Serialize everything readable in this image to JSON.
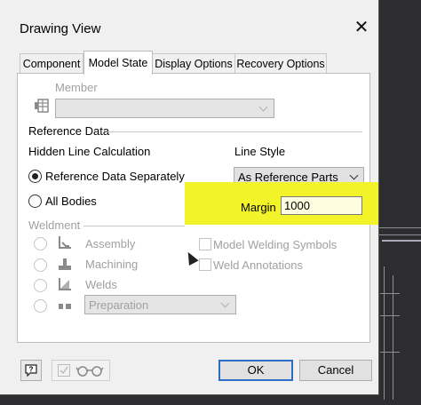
{
  "window": {
    "title": "Drawing View",
    "close_glyph": "✕"
  },
  "tabs": [
    {
      "label": "Component"
    },
    {
      "label": "Model State"
    },
    {
      "label": "Display Options"
    },
    {
      "label": "Recovery Options"
    }
  ],
  "member": {
    "label": "Member",
    "value": ""
  },
  "reference_data": {
    "section_label": "Reference Data",
    "hidden_line_label": "Hidden Line Calculation",
    "options": [
      {
        "label": "Reference Data Separately",
        "selected": true
      },
      {
        "label": "All Bodies",
        "selected": false
      }
    ],
    "line_style_label": "Line Style",
    "line_style_value": "As Reference Parts",
    "margin_label": "Margin",
    "margin_value": "1000"
  },
  "weldment": {
    "section_label": "Weldment",
    "options": [
      {
        "label": "Assembly",
        "icon": "assembly-icon"
      },
      {
        "label": "Machining",
        "icon": "machining-icon"
      },
      {
        "label": "Welds",
        "icon": "welds-icon"
      },
      {
        "label": "",
        "icon": "preparation-icon"
      }
    ],
    "preparation_value": "Preparation",
    "checkboxes": [
      {
        "label": "Model Welding Symbols",
        "checked": false
      },
      {
        "label": "Weld Annotations",
        "checked": false
      }
    ]
  },
  "footer": {
    "ok_label": "OK",
    "cancel_label": "Cancel"
  },
  "colors": {
    "highlight": "#f3f32a",
    "accent": "#2c6fc7"
  }
}
